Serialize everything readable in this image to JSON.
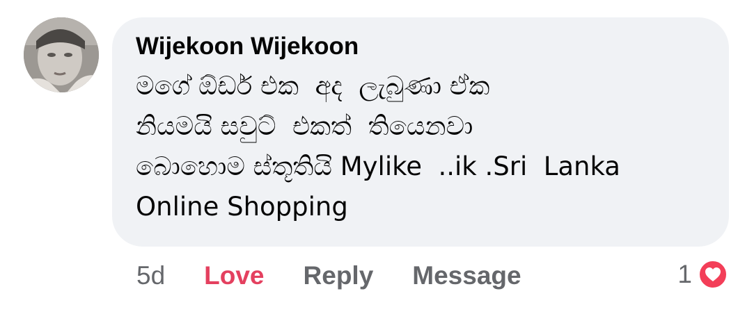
{
  "comment": {
    "author": "Wijekoon Wijekoon",
    "text": "මගේ ඕඩර් එක  අද  ලැබුණා ඒක\nනියමයි සවුට්  එකත්  තියෙනවා\nබොහොම ස්තූතියි Mylike  ..ik .Sri  Lanka\nOnline Shopping",
    "timestamp": "5d",
    "actions": {
      "love": "Love",
      "reply": "Reply",
      "message": "Message"
    },
    "reactions": {
      "count": "1",
      "icon": "heart-icon",
      "color": "#f33e58"
    }
  },
  "colors": {
    "bubble": "#f0f2f5",
    "love_active": "#e4405f",
    "secondary_text": "#65676b",
    "primary_text": "#050505"
  }
}
